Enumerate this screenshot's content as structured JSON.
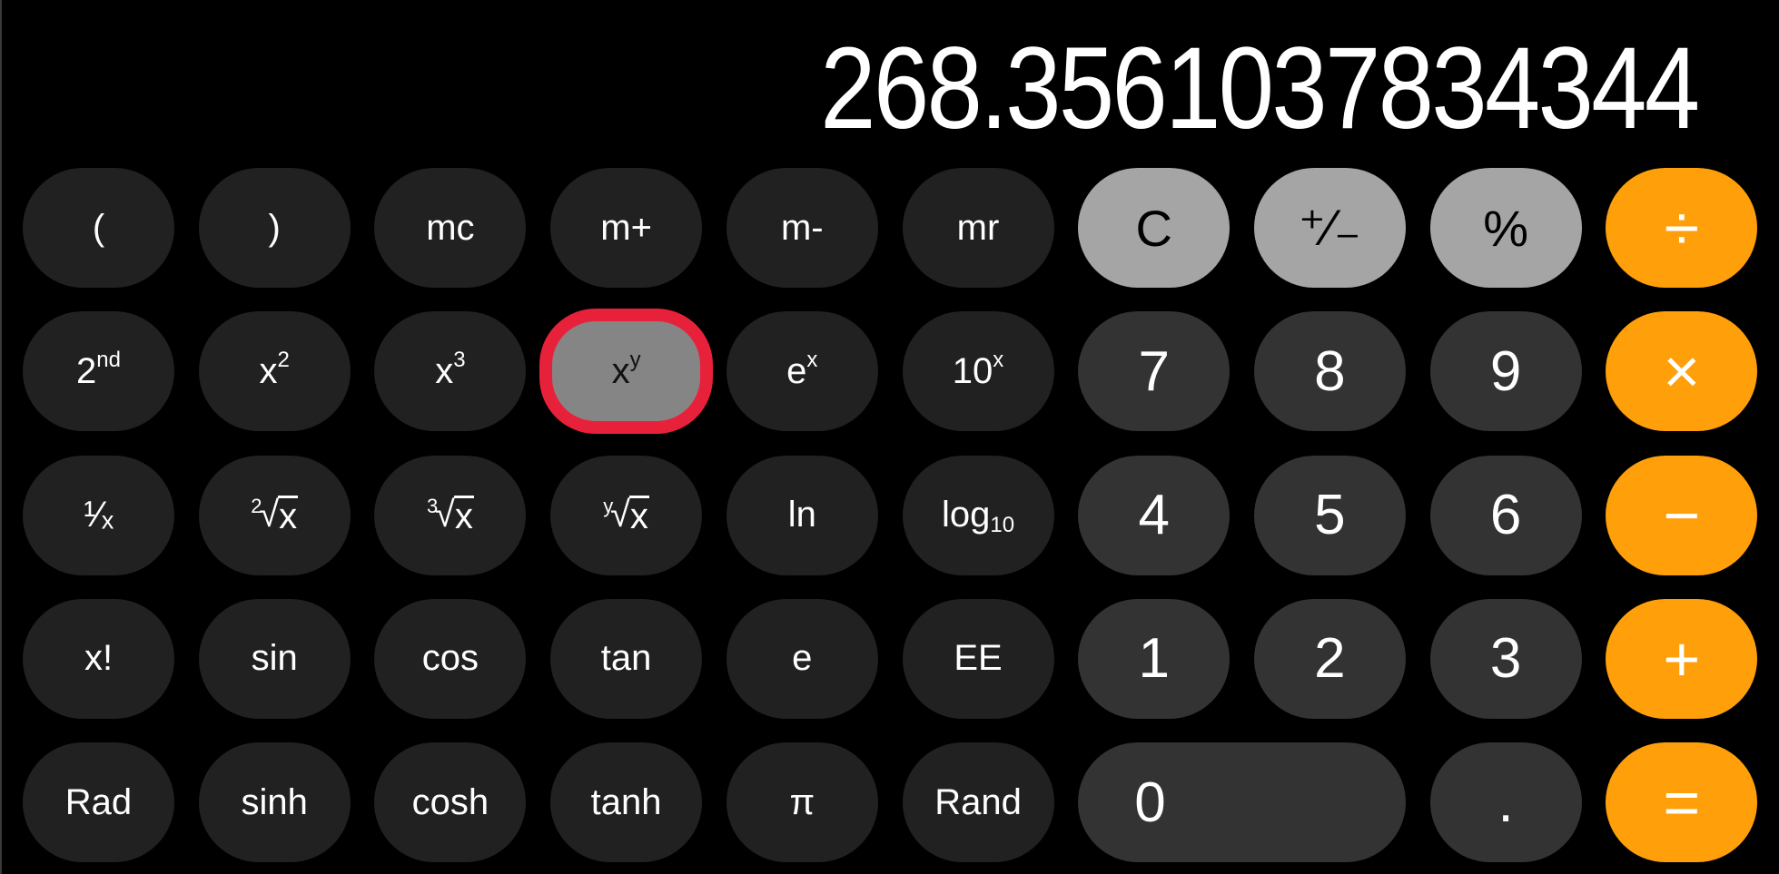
{
  "app": "Calculator",
  "display": {
    "value": "268.3561037834344"
  },
  "colors": {
    "background": "#000000",
    "function_key": "#212121",
    "number_key": "#333333",
    "utility_key": "#a5a5a5",
    "operator_key": "#ff9f0a",
    "active_key": "#858585",
    "highlight_outline": "#e8213a",
    "text_light": "#ffffff",
    "text_dark": "#000000"
  },
  "highlighted_key": "x^y",
  "rows": [
    [
      {
        "id": "open-paren",
        "label": "(",
        "kind": "fn"
      },
      {
        "id": "close-paren",
        "label": ")",
        "kind": "fn"
      },
      {
        "id": "mc",
        "label": "mc",
        "kind": "fn"
      },
      {
        "id": "m-plus",
        "label": "m+",
        "kind": "fn"
      },
      {
        "id": "m-minus",
        "label": "m-",
        "kind": "fn"
      },
      {
        "id": "mr",
        "label": "mr",
        "kind": "fn"
      },
      {
        "id": "clear",
        "label": "C",
        "kind": "util"
      },
      {
        "id": "plus-minus",
        "label": "⁺∕₋",
        "kind": "util"
      },
      {
        "id": "percent",
        "label": "%",
        "kind": "util"
      },
      {
        "id": "divide",
        "label": "÷",
        "kind": "op"
      }
    ],
    [
      {
        "id": "second",
        "label": "2",
        "sup": "nd",
        "kind": "fn"
      },
      {
        "id": "x-squared",
        "label": "x",
        "sup": "2",
        "kind": "fn"
      },
      {
        "id": "x-cubed",
        "label": "x",
        "sup": "3",
        "kind": "fn"
      },
      {
        "id": "x-power-y",
        "label": "x",
        "sup": "y",
        "kind": "fn",
        "active": true
      },
      {
        "id": "e-power-x",
        "label": "e",
        "sup": "x",
        "kind": "fn"
      },
      {
        "id": "ten-power-x",
        "label": "10",
        "sup": "x",
        "kind": "fn"
      },
      {
        "id": "seven",
        "label": "7",
        "kind": "num"
      },
      {
        "id": "eight",
        "label": "8",
        "kind": "num"
      },
      {
        "id": "nine",
        "label": "9",
        "kind": "num"
      },
      {
        "id": "multiply",
        "label": "×",
        "kind": "op"
      }
    ],
    [
      {
        "id": "reciprocal",
        "label": "¹∕ₓ",
        "kind": "fn"
      },
      {
        "id": "square-root",
        "label": "x",
        "root": "2",
        "kind": "fn"
      },
      {
        "id": "cube-root",
        "label": "x",
        "root": "3",
        "kind": "fn"
      },
      {
        "id": "y-root",
        "label": "x",
        "root": "y",
        "kind": "fn"
      },
      {
        "id": "ln",
        "label": "ln",
        "kind": "fn"
      },
      {
        "id": "log10",
        "label": "log",
        "sub": "10",
        "kind": "fn"
      },
      {
        "id": "four",
        "label": "4",
        "kind": "num"
      },
      {
        "id": "five",
        "label": "5",
        "kind": "num"
      },
      {
        "id": "six",
        "label": "6",
        "kind": "num"
      },
      {
        "id": "minus",
        "label": "−",
        "kind": "op"
      }
    ],
    [
      {
        "id": "factorial",
        "label": "x!",
        "kind": "fn"
      },
      {
        "id": "sin",
        "label": "sin",
        "kind": "fn"
      },
      {
        "id": "cos",
        "label": "cos",
        "kind": "fn"
      },
      {
        "id": "tan",
        "label": "tan",
        "kind": "fn"
      },
      {
        "id": "e-const",
        "label": "e",
        "kind": "fn"
      },
      {
        "id": "ee",
        "label": "EE",
        "kind": "fn"
      },
      {
        "id": "one",
        "label": "1",
        "kind": "num"
      },
      {
        "id": "two",
        "label": "2",
        "kind": "num"
      },
      {
        "id": "three",
        "label": "3",
        "kind": "num"
      },
      {
        "id": "plus",
        "label": "+",
        "kind": "op"
      }
    ],
    [
      {
        "id": "rad",
        "label": "Rad",
        "kind": "fn"
      },
      {
        "id": "sinh",
        "label": "sinh",
        "kind": "fn"
      },
      {
        "id": "cosh",
        "label": "cosh",
        "kind": "fn"
      },
      {
        "id": "tanh",
        "label": "tanh",
        "kind": "fn"
      },
      {
        "id": "pi",
        "label": "π",
        "kind": "fn"
      },
      {
        "id": "rand",
        "label": "Rand",
        "kind": "fn"
      },
      {
        "id": "zero",
        "label": "0",
        "kind": "num",
        "wide": true
      },
      {
        "id": "decimal",
        "label": ".",
        "kind": "num"
      },
      {
        "id": "equals",
        "label": "=",
        "kind": "op"
      }
    ]
  ]
}
